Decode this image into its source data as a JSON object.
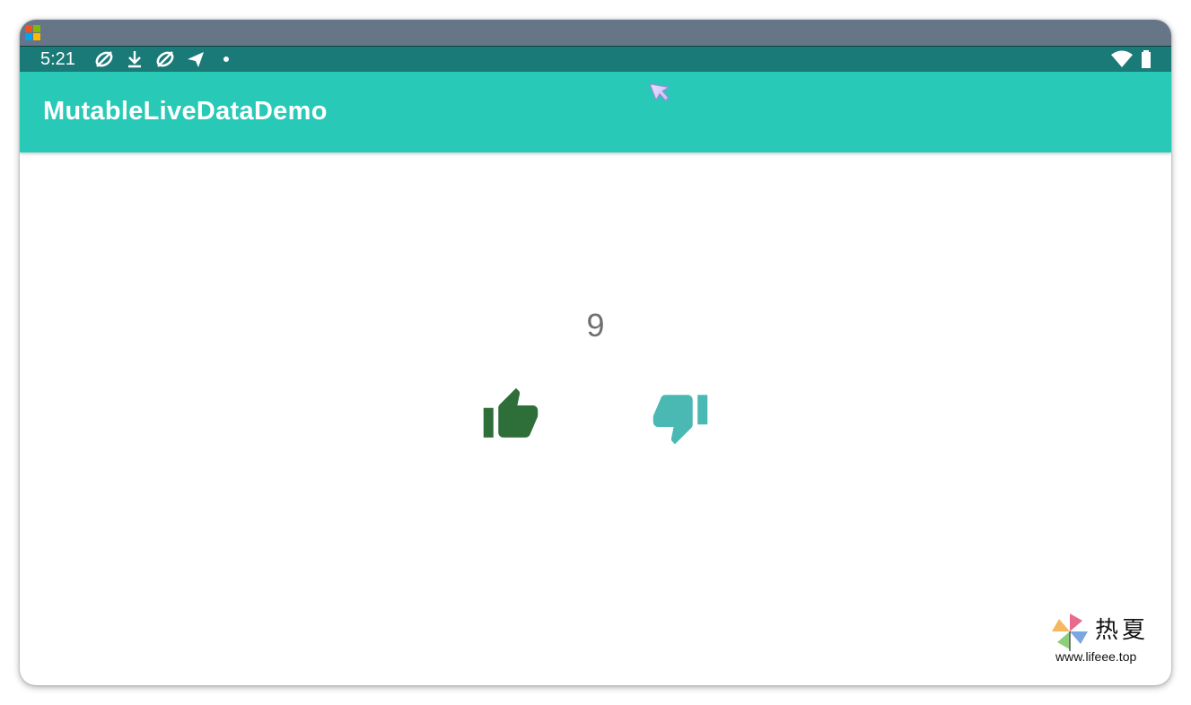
{
  "window": {
    "titlebar_color": "#667587"
  },
  "status_bar": {
    "time": "5:21",
    "left_icons": [
      "no-sync-icon",
      "download-icon",
      "no-sync-icon",
      "send-icon",
      "dot-icon"
    ],
    "right_icons": [
      "wifi-icon",
      "battery-icon"
    ],
    "color": "#1a7a78"
  },
  "app_bar": {
    "title": "MutableLiveDataDemo",
    "color": "#29c9b8"
  },
  "main": {
    "counter_value": "9",
    "like_button": {
      "icon": "thumb-up-icon",
      "color": "#2e6e38"
    },
    "dislike_button": {
      "icon": "thumb-down-icon",
      "color": "#4ab9b3"
    }
  },
  "watermark": {
    "chinese_text": "热夏",
    "url": "www.lifeee.top"
  }
}
